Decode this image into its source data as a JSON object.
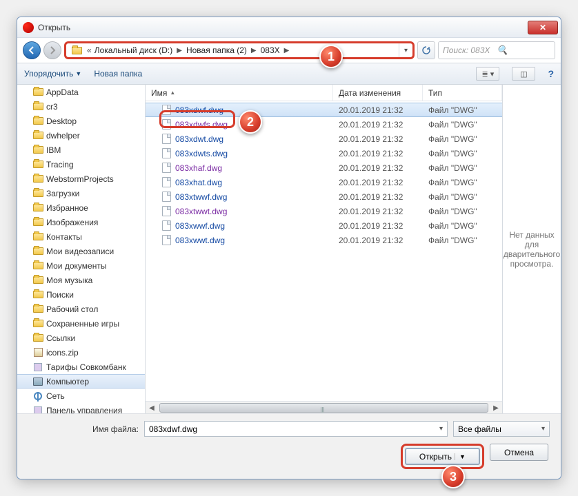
{
  "title": "Открыть",
  "breadcrumb": {
    "prefix": "«",
    "p1": "Локальный диск (D:)",
    "p2": "Новая папка (2)",
    "p3": "083X"
  },
  "search": {
    "placeholder": "Поиск: 083X"
  },
  "toolbar": {
    "organize": "Упорядочить",
    "newfolder": "Новая папка"
  },
  "columns": {
    "name": "Имя",
    "date": "Дата изменения",
    "type": "Тип"
  },
  "sidebar": [
    {
      "label": "AppData",
      "icon": "fld"
    },
    {
      "label": "cr3",
      "icon": "fld"
    },
    {
      "label": "Desktop",
      "icon": "fld"
    },
    {
      "label": "dwhelper",
      "icon": "fld"
    },
    {
      "label": "IBM",
      "icon": "fld"
    },
    {
      "label": "Tracing",
      "icon": "fld"
    },
    {
      "label": "WebstormProjects",
      "icon": "fld"
    },
    {
      "label": "Загрузки",
      "icon": "fld"
    },
    {
      "label": "Избранное",
      "icon": "fld"
    },
    {
      "label": "Изображения",
      "icon": "fld"
    },
    {
      "label": "Контакты",
      "icon": "fld"
    },
    {
      "label": "Мои видеозаписи",
      "icon": "fld"
    },
    {
      "label": "Мои документы",
      "icon": "fld"
    },
    {
      "label": "Моя музыка",
      "icon": "fld"
    },
    {
      "label": "Поиски",
      "icon": "fld"
    },
    {
      "label": "Рабочий стол",
      "icon": "fld"
    },
    {
      "label": "Сохраненные игры",
      "icon": "fld"
    },
    {
      "label": "Ссылки",
      "icon": "fld"
    },
    {
      "label": "icons.zip",
      "icon": "zip"
    },
    {
      "label": "Тарифы Совкомбанк",
      "icon": "box"
    },
    {
      "label": "Компьютер",
      "icon": "comp",
      "sel": true
    },
    {
      "label": "Сеть",
      "icon": "net"
    },
    {
      "label": "Панель управления",
      "icon": "box"
    }
  ],
  "files": [
    {
      "name": "083xdwf.dwg",
      "date": "20.01.2019 21:32",
      "type": "Файл \"DWG\"",
      "hl": true
    },
    {
      "name": "083xdwfs.dwg",
      "date": "20.01.2019 21:32",
      "type": "Файл \"DWG\"",
      "visited": true
    },
    {
      "name": "083xdwt.dwg",
      "date": "20.01.2019 21:32",
      "type": "Файл \"DWG\""
    },
    {
      "name": "083xdwts.dwg",
      "date": "20.01.2019 21:32",
      "type": "Файл \"DWG\""
    },
    {
      "name": "083xhaf.dwg",
      "date": "20.01.2019 21:32",
      "type": "Файл \"DWG\"",
      "visited": true
    },
    {
      "name": "083xhat.dwg",
      "date": "20.01.2019 21:32",
      "type": "Файл \"DWG\""
    },
    {
      "name": "083xtwwf.dwg",
      "date": "20.01.2019 21:32",
      "type": "Файл \"DWG\""
    },
    {
      "name": "083xtwwt.dwg",
      "date": "20.01.2019 21:32",
      "type": "Файл \"DWG\"",
      "visited": true
    },
    {
      "name": "083xwwf.dwg",
      "date": "20.01.2019 21:32",
      "type": "Файл \"DWG\""
    },
    {
      "name": "083xwwt.dwg",
      "date": "20.01.2019 21:32",
      "type": "Файл \"DWG\""
    }
  ],
  "preview": "Нет данных для дварительного просмотра.",
  "footer": {
    "fnamelabel": "Имя файла:",
    "fname": "083xdwf.dwg",
    "filter": "Все файлы",
    "open": "Открыть",
    "cancel": "Отмена"
  },
  "badges": {
    "b1": "1",
    "b2": "2",
    "b3": "3"
  }
}
